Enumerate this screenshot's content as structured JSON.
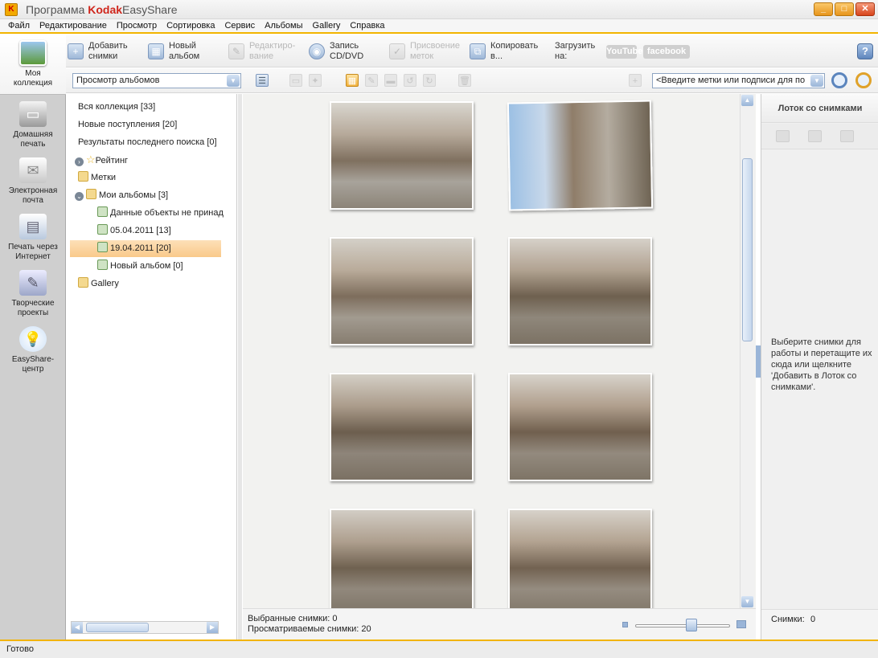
{
  "window": {
    "title_prefix": "Программа",
    "title_brand": "Kodak",
    "title_suffix": "EasyShare",
    "minimize": "_",
    "maximize": "□",
    "close": "✕"
  },
  "menu": [
    "Файл",
    "Редактирование",
    "Просмотр",
    "Сортировка",
    "Сервис",
    "Альбомы",
    "Gallery",
    "Справка"
  ],
  "toolbar": {
    "add": "Добавить\nснимки",
    "new_album": "Новый\nальбом",
    "edit": "Редактиро-\nвание",
    "burn": "Запись\nCD/DVD",
    "tag": "Присвоение\nметок",
    "copy": "Копировать\nв...",
    "upload": "Загрузить\nна:",
    "youtube": "YouTube",
    "facebook": "facebook",
    "help": "?"
  },
  "toolbar2": {
    "view_select": "Просмотр альбомов",
    "tag_search": "<Введите метки или подписи для по"
  },
  "leftnav": [
    {
      "label": "Моя\nколлекция",
      "icon": "collection-icon",
      "active": true
    },
    {
      "label": "Домашняя\nпечать",
      "icon": "printer-icon"
    },
    {
      "label": "Электронная\nпочта",
      "icon": "email-icon"
    },
    {
      "label": "Печать через\nИнтернет",
      "icon": "online-print-icon"
    },
    {
      "label": "Творческие\nпроекты",
      "icon": "creative-projects-icon"
    },
    {
      "label": "EasyShare-\nцентр",
      "icon": "lightbulb-icon"
    }
  ],
  "tree": {
    "all": "Вся коллекция [33]",
    "new": "Новые поступления [20]",
    "search": "Результаты последнего поиска [0]",
    "rating": "Рейтинг",
    "tags": "Метки",
    "albums": "Мои альбомы [3]",
    "album1": "Данные объекты не принад",
    "album2": "05.04.2011 [13]",
    "album3": "19.04.2011 [20]",
    "album4": "Новый альбом [0]",
    "gallery": "Gallery"
  },
  "status": {
    "selected": "Выбранные снимки: 0",
    "viewed": "Просматриваемые снимки: 20",
    "ready": "Готово"
  },
  "tray": {
    "title": "Лоток со снимками",
    "message": "Выберите снимки для работы и перетащите их сюда или щелкните 'Добавить в Лоток со снимками'.",
    "count_label": "Снимки:",
    "count": "0"
  },
  "colors": {
    "accent": "#f2b400",
    "selection": "#f9c98a",
    "nav_bg": "#cfcfcf"
  }
}
